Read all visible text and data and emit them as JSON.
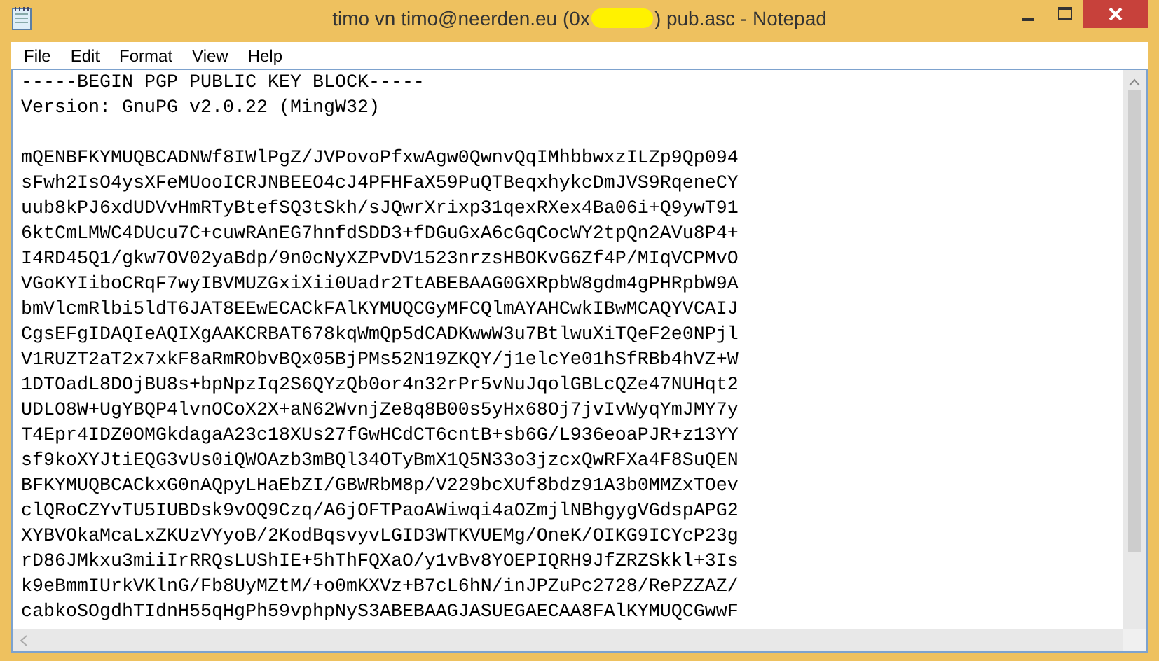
{
  "window": {
    "title_start": "timo vn timo@neerden.eu (0x",
    "title_end": ") pub.asc - Notepad",
    "redacted": true
  },
  "menu": [
    "File",
    "Edit",
    "Format",
    "View",
    "Help"
  ],
  "document": {
    "header": [
      "-----BEGIN PGP PUBLIC KEY BLOCK-----",
      "Version: GnuPG v2.0.22 (MingW32)"
    ],
    "lines": [
      "mQENBFKYMUQBCADNWf8IWlPgZ/JVPovoPfxwAgw0QwnvQqIMhbbwxzILZp9Qp094",
      "sFwh2IsO4ysXFeMUooICRJNBEEO4cJ4PFHFaX59PuQTBeqxhykcDmJVS9RqeneCY",
      "uub8kPJ6xdUDVvHmRTyBtefSQ3tSkh/sJQwrXrixp31qexRXex4Ba06i+Q9ywT91",
      "6ktCmLMWC4DUcu7C+cuwRAnEG7hnfdSDD3+fDGuGxA6cGqCocWY2tpQn2AVu8P4+",
      "I4RD45Q1/gkw7OV02yaBdp/9n0cNyXZPvDV1523nrzsHBOKvG6Zf4P/MIqVCPMvO",
      "VGoKYIiboCRqF7wyIBVMUZGxiXii0Uadr2TtABEBAAG0GXRpbW8gdm4gPHRpbW9A",
      "bmVlcmRlbi5ldT6JAT8EEwECACkFAlKYMUQCGyMFCQlmAYAHCwkIBwMCAQYVCAIJ",
      "CgsEFgIDAQIeAQIXgAAKCRBAT678kqWmQp5dCADKwwW3u7BtlwuXiTQeF2e0NPjl",
      "V1RUZT2aT2x7xkF8aRmRObvBQx05BjPMs52N19ZKQY/j1elcYe01hSfRBb4hVZ+W",
      "1DTOadL8DOjBU8s+bpNpzIq2S6QYzQb0or4n32rPr5vNuJqolGBLcQZe47NUHqt2",
      "UDLO8W+UgYBQP4lvnOCoX2X+aN62WvnjZe8q8B00s5yHx68Oj7jvIvWyqYmJMY7y",
      "T4Epr4IDZ0OMGkdagaA23c18XUs27fGwHCdCT6cntB+sb6G/L936eoaPJR+z13YY",
      "sf9koXYJtiEQG3vUs0iQWOAzb3mBQl34OTyBmX1Q5N33o3jzcxQwRFXa4F8SuQEN",
      "BFKYMUQBCACkxG0nAQpyLHaEbZI/GBWRbM8p/V229bcXUf8bdz91A3b0MMZxTOev",
      "clQRoCZYvTU5IUBDsk9vOQ9Czq/A6jOFTPaoAWiwqi4aOZmjlNBhgygVGdspAPG2",
      "XYBVOkaMcaLxZKUzVYyoB/2KodBqsvyvLGID3WTKVUEMg/OneK/OIKG9ICYcP23g",
      "rD86JMkxu3miiIrRRQsLUShIE+5hThFQXaO/y1vBv8YOEPIQRH9JfZRZSkkl+3Is",
      "k9eBmmIUrkVKlnG/Fb8UyMZtM/+o0mKXVz+B7cL6hN/inJPZuPc2728/RePZZAZ/",
      "cabkoSOgdhTIdnH55qHgPh59vphpNyS3ABEBAAGJASUEGAECAA8FAlKYMUQCGwwF"
    ]
  }
}
